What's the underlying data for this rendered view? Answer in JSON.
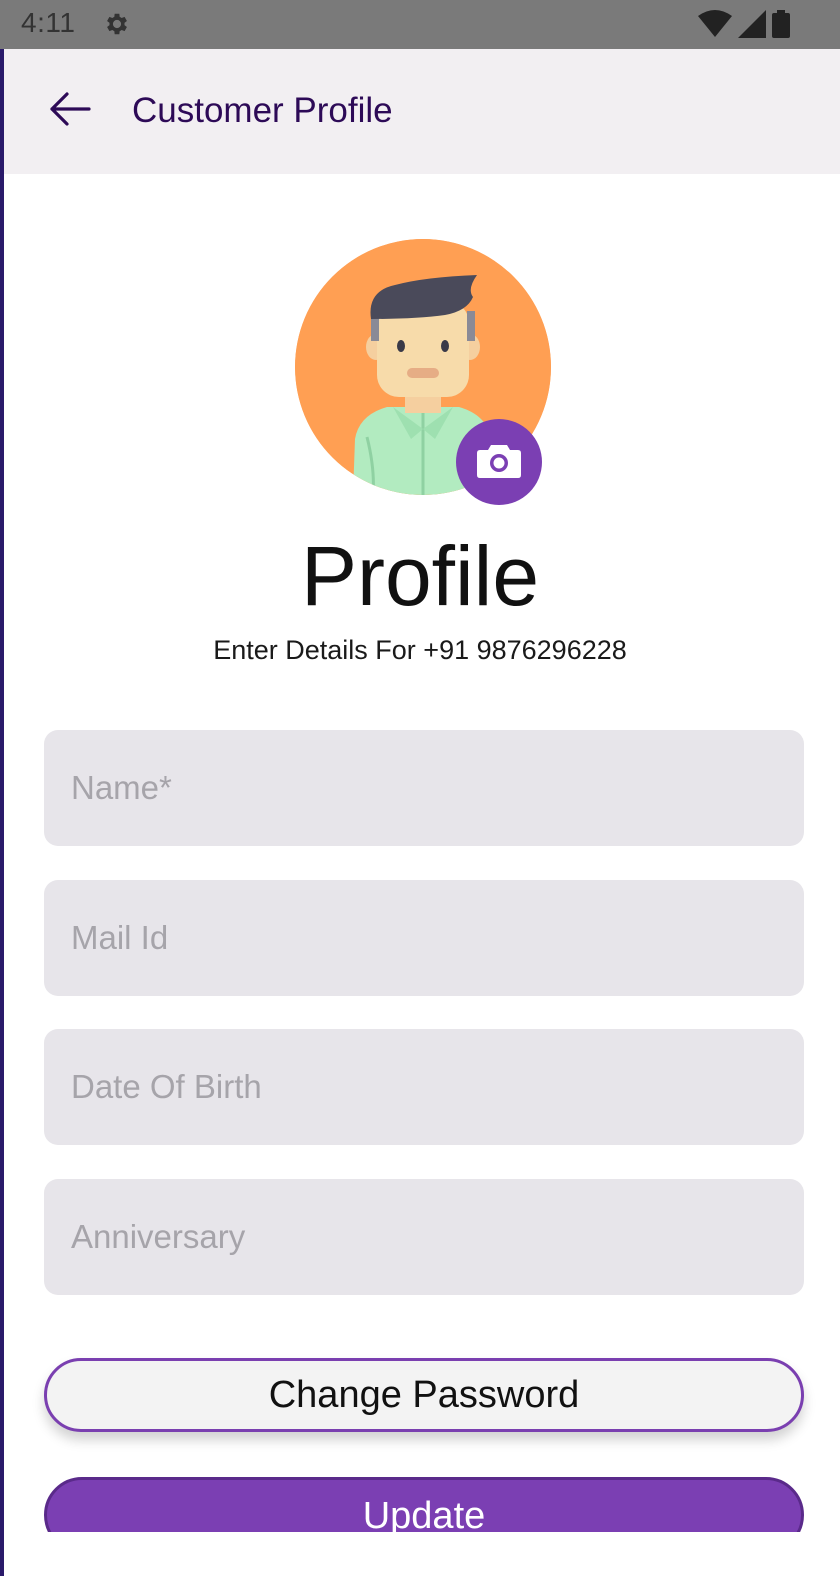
{
  "status_bar": {
    "time": "4:11",
    "icons": [
      "gear-icon",
      "wifi-icon",
      "cell-signal-icon",
      "battery-icon"
    ]
  },
  "app_bar": {
    "title": "Customer Profile",
    "back_icon": "arrow-back-icon"
  },
  "profile": {
    "heading": "Profile",
    "subtitle": "Enter Details For +91 9876296228",
    "avatar_icon": "user-avatar",
    "camera_icon": "camera-icon"
  },
  "form": {
    "name_placeholder": "Name*",
    "mail_placeholder": "Mail Id",
    "dob_placeholder": "Date Of Birth",
    "anniversary_placeholder": "Anniversary",
    "name_value": "",
    "mail_value": "",
    "dob_value": "",
    "anniversary_value": ""
  },
  "buttons": {
    "change_password": "Change Password",
    "update": "Update"
  },
  "colors": {
    "accent": "#7b3fb3",
    "title": "#2d0a57",
    "app_bar_bg": "#f2eff2",
    "field_bg": "#e7e5ea",
    "avatar_bg": "#ff9f53"
  }
}
